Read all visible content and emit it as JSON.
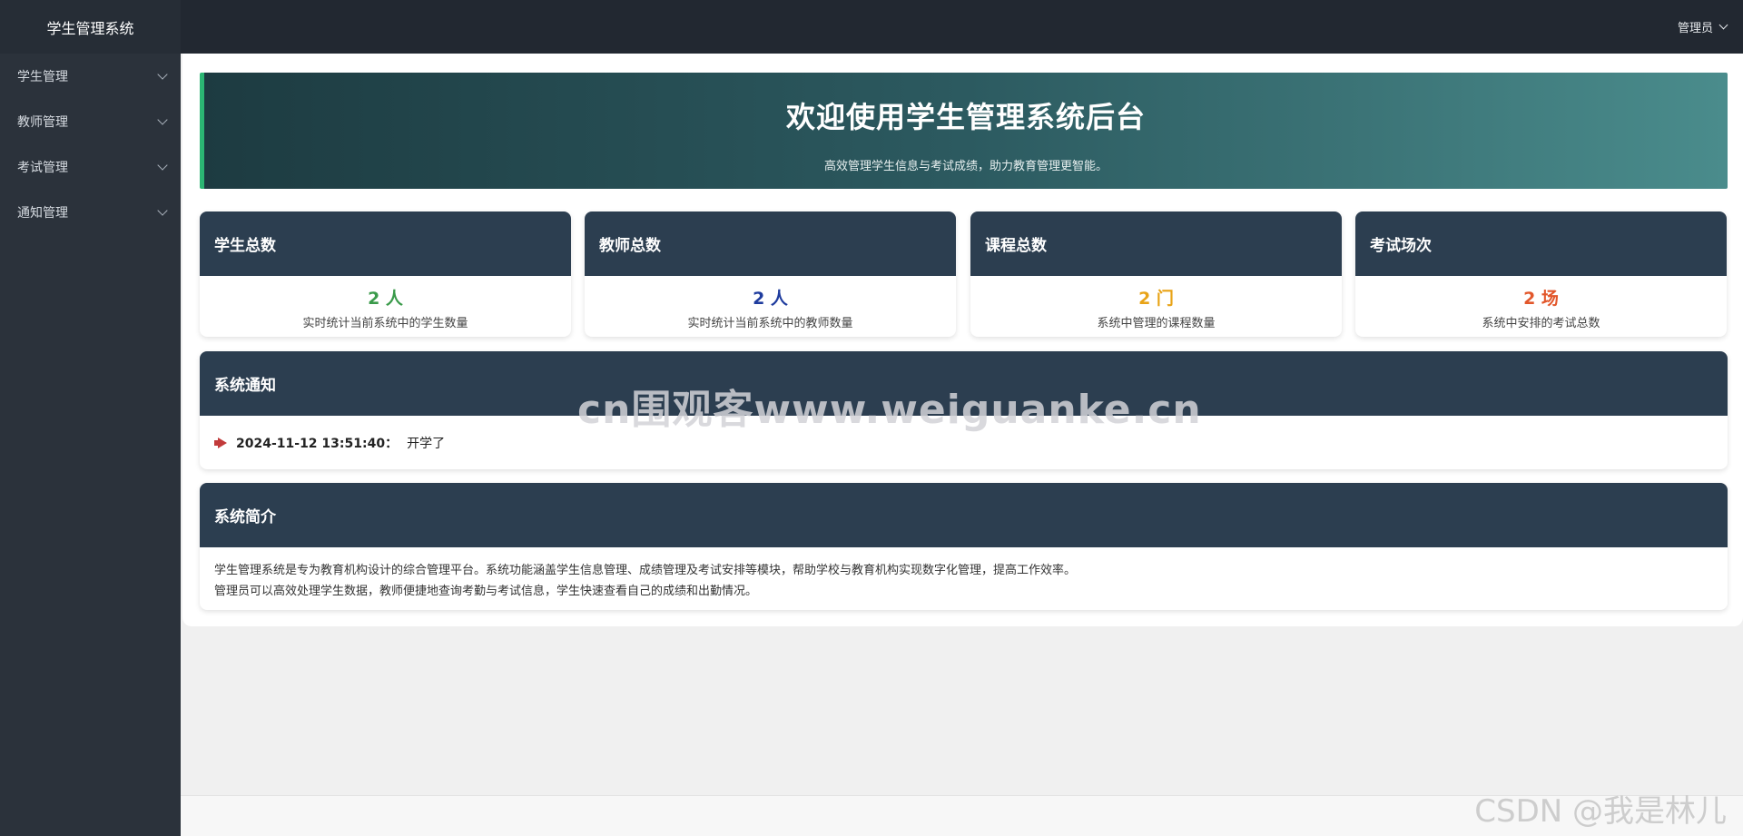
{
  "sidebar": {
    "brand": "学生管理系统",
    "items": [
      {
        "label": "学生管理"
      },
      {
        "label": "教师管理"
      },
      {
        "label": "考试管理"
      },
      {
        "label": "通知管理"
      }
    ]
  },
  "header": {
    "user": "管理员"
  },
  "banner": {
    "title": "欢迎使用学生管理系统后台",
    "subtitle": "高效管理学生信息与考试成绩，助力教育管理更智能。"
  },
  "stats": [
    {
      "title": "学生总数",
      "value": "2 人",
      "desc": "实时统计当前系统中的学生数量",
      "color": "#3a9a4a"
    },
    {
      "title": "教师总数",
      "value": "2 人",
      "desc": "实时统计当前系统中的教师数量",
      "color": "#1f3c9e"
    },
    {
      "title": "课程总数",
      "value": "2 门",
      "desc": "系统中管理的课程数量",
      "color": "#e8a317"
    },
    {
      "title": "考试场次",
      "value": "2 场",
      "desc": "系统中安排的考试总数",
      "color": "#e2572b"
    }
  ],
  "notice": {
    "title": "系统通知",
    "icon": "megaphone-icon",
    "time": "2024-11-12 13:51:40：",
    "content": "开学了"
  },
  "intro": {
    "title": "系统简介",
    "lines": [
      "学生管理系统是专为教育机构设计的综合管理平台。系统功能涵盖学生信息管理、成绩管理及考试安排等模块，帮助学校与教育机构实现数字化管理，提高工作效率。",
      "管理员可以高效处理学生数据，教师便捷地查询考勤与考试信息，学生快速查看自己的成绩和出勤情况。"
    ]
  },
  "watermarks": {
    "center": "cn围观客www.weiguanke.cn",
    "corner": "CSDN @我是林儿"
  }
}
